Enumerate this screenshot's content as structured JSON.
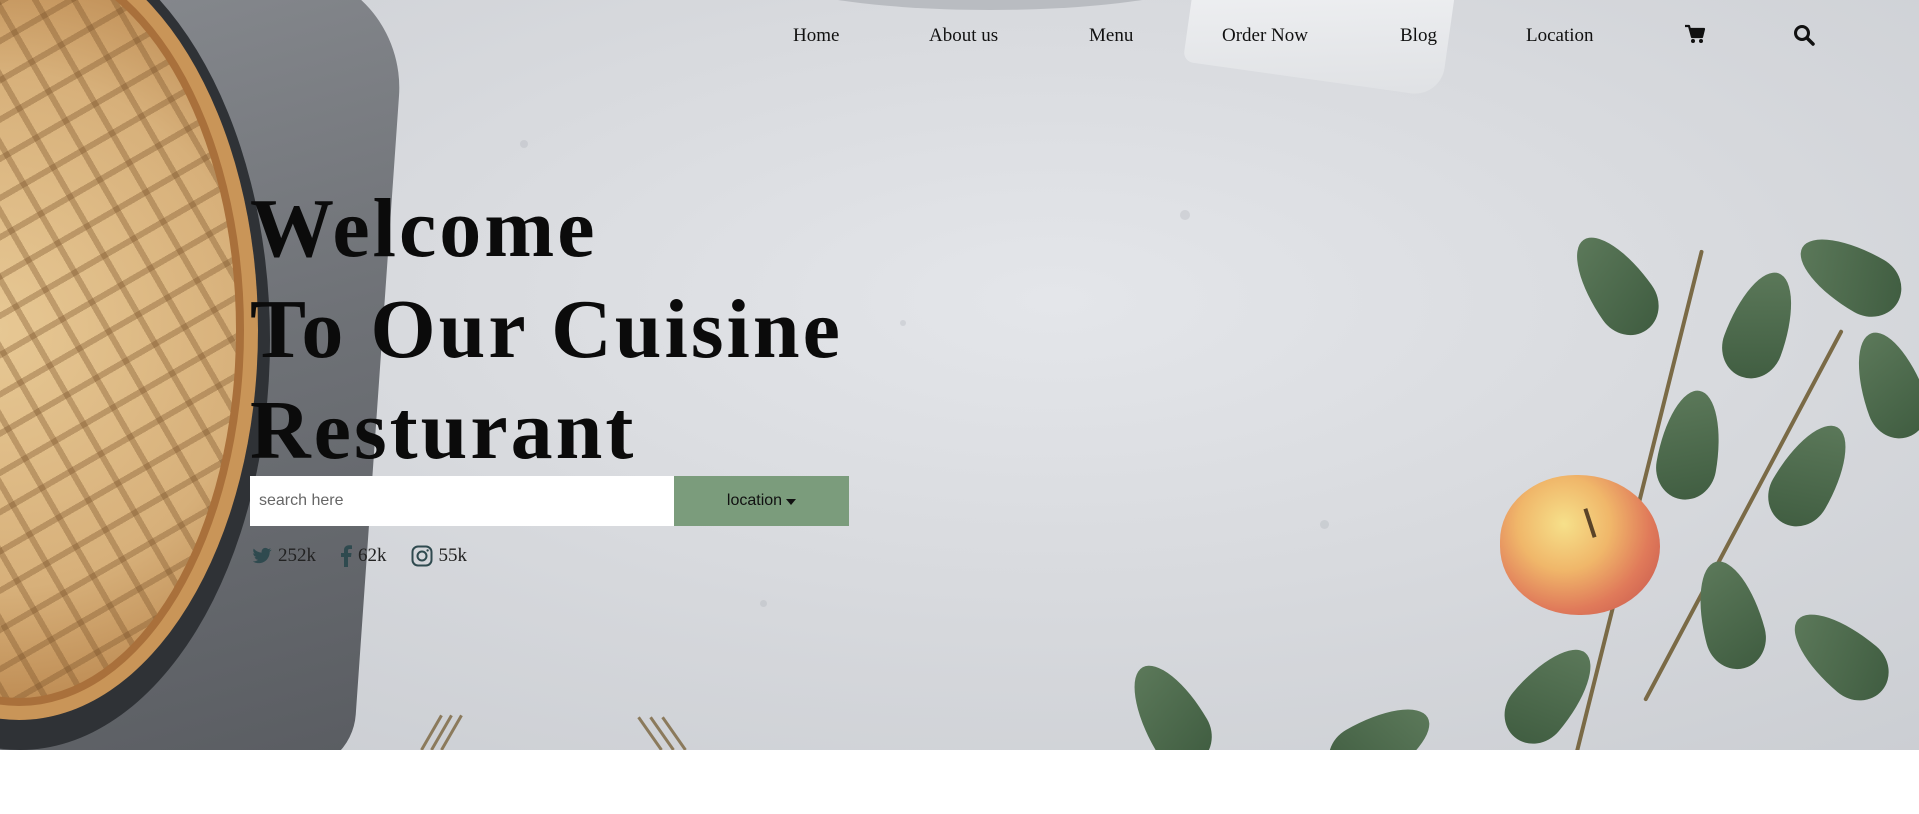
{
  "nav": {
    "links": [
      "Home",
      "About us",
      "Menu",
      "Order Now",
      "Blog",
      "Location"
    ],
    "cart_icon": "cart-icon",
    "search_icon": "search-icon"
  },
  "hero": {
    "title_lines": [
      "Welcome",
      "To Our Cuisine",
      "Resturant"
    ],
    "search": {
      "placeholder": "search here"
    },
    "location_button": "location",
    "social": [
      {
        "icon": "twitter-icon",
        "count": "252k"
      },
      {
        "icon": "facebook-icon",
        "count": "62k"
      },
      {
        "icon": "instagram-icon",
        "count": "55k"
      }
    ]
  },
  "colors": {
    "accent_green": "#7b9c7c",
    "text_dark": "#0b0b0b",
    "social_icon": "#2f4a4f"
  }
}
